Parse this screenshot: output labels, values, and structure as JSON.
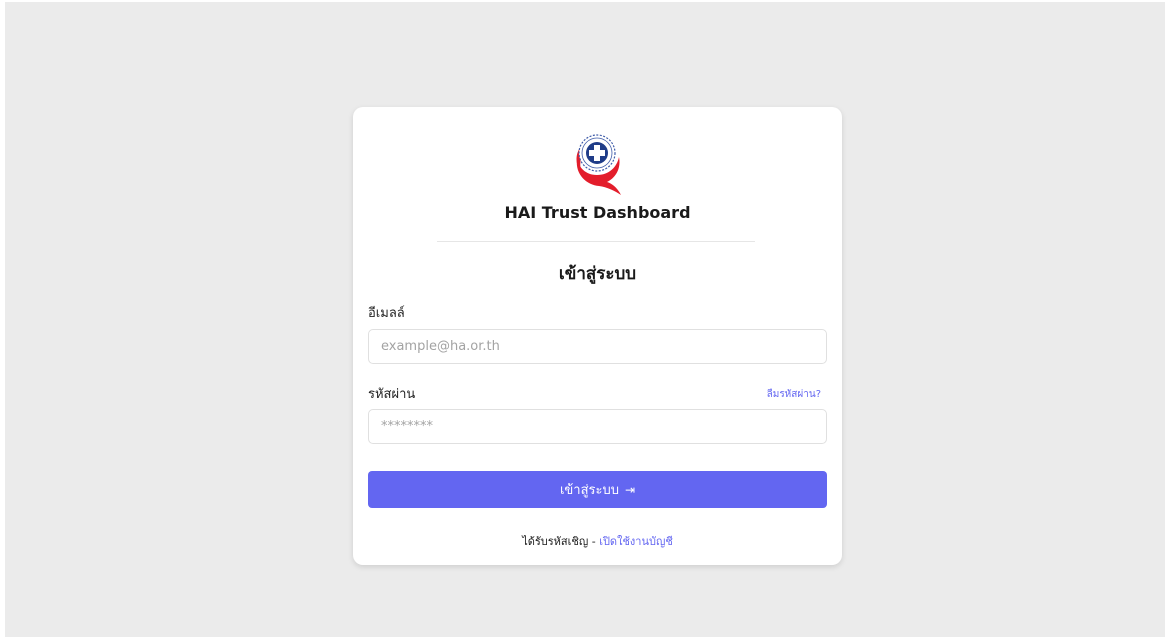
{
  "app": {
    "title": "HAI Trust Dashboard"
  },
  "login": {
    "heading": "เข้าสู่ระบบ",
    "email_label": "อีเมลล์",
    "email_placeholder": "example@ha.or.th",
    "email_value": "",
    "password_label": "รหัสผ่าน",
    "password_placeholder": "********",
    "password_value": "",
    "forgot_link": "ลืมรหัสผ่าน?",
    "submit_label": "เข้าสู่ระบบ",
    "submit_icon": "login-arrow-icon",
    "invite_text": "ได้รับรหัสเชิญ - ",
    "activate_link": "เปิดใช้งานบัญชี"
  },
  "colors": {
    "accent": "#6366f1",
    "background": "#ebebeb",
    "logo_red": "#e31d2b",
    "logo_blue": "#1f3c88"
  }
}
